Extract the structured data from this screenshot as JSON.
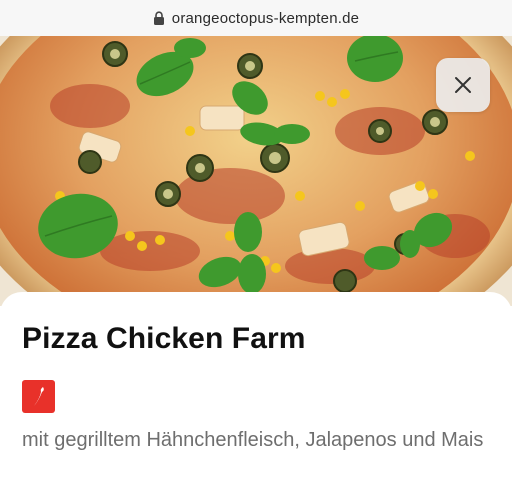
{
  "browser": {
    "url": "orangeoctopus-kempten.de",
    "lock_icon": "lock-icon"
  },
  "product": {
    "image_subject": "pizza-photo",
    "close_icon": "close-icon",
    "title": "Pizza Chicken Farm",
    "spicy_icon": "chili-icon",
    "description": "mit gegrilltem Hähnchenfleisch, Jalapenos und Mais"
  },
  "colors": {
    "spicy_badge": "#e8312a",
    "title": "#111111",
    "description": "#6e6e6e"
  }
}
